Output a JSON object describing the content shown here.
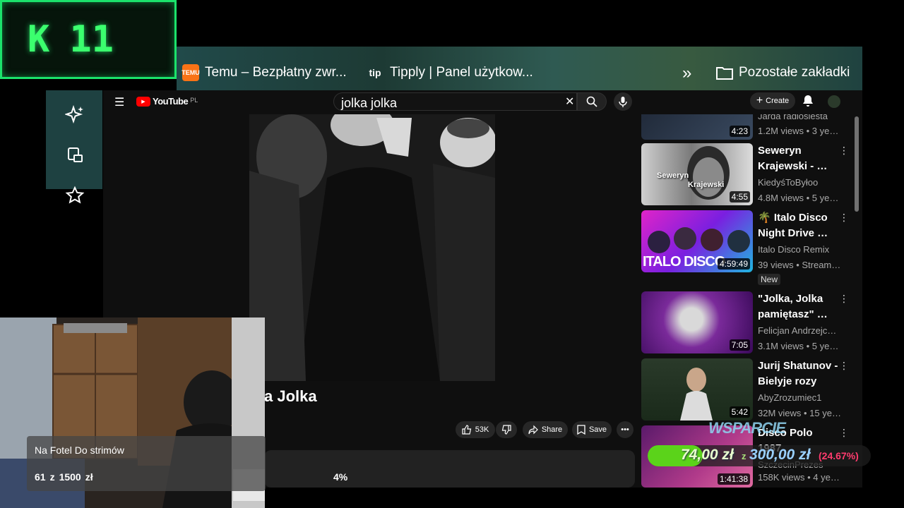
{
  "overlay": {
    "logo_letter": "K",
    "logo_number": "11",
    "goal_title": "Na Fotel Do strimów",
    "goal_current": "61",
    "goal_sep": "z",
    "goal_target": "1500",
    "goal_currency": "zł",
    "goal_percent": "4%",
    "support_label": "WSPARCIE",
    "donation_current": "74,00 zł",
    "donation_sep": "z",
    "donation_target": "300,00 zł",
    "donation_percent": "(24.67%)"
  },
  "bookmarks": [
    {
      "label": "Temu – Bezpłatny zwr...",
      "icon": "temu-icon",
      "icon_text": "TEMU"
    },
    {
      "label": "Tipply | Panel użytkow...",
      "icon": "tipply-icon",
      "icon_text": "tip"
    }
  ],
  "bookmarks_other": "Pozostałe zakładki",
  "youtube": {
    "logo_text": "YouTube",
    "region": "PL",
    "search_value": "jolka jolka",
    "create_label": "Create",
    "video_title_partial": "a Jolka",
    "likes": "53K",
    "share_label": "Share",
    "save_label": "Save"
  },
  "related": [
    {
      "title": "",
      "channel": "Jarda radiosiesta",
      "meta": "1.2M views • 3 ye…",
      "duration": "4:23",
      "badge": ""
    },
    {
      "title": "Seweryn Krajewski - …",
      "channel": "KiedyśToByłoo",
      "meta": "4.8M views • 5 ye…",
      "duration": "4:55",
      "badge": "",
      "thumb_text1": "Seweryn",
      "thumb_text2": "Krajewski"
    },
    {
      "title": "🌴 Italo Disco Night Drive …",
      "channel": "Italo Disco Remix",
      "meta": "39 views • Stream…",
      "duration": "4:59:49",
      "badge": "New",
      "thumb_text1": "ITALO DISCO"
    },
    {
      "title": "\"Jolka, Jolka pamiętasz\" …",
      "channel": "Felicjan Andrzejc…",
      "meta": "3.1M views • 5 ye…",
      "duration": "7:05",
      "badge": ""
    },
    {
      "title": "Jurij Shatunov - Bielyje rozy",
      "channel": "AbyZrozumiec1",
      "meta": "32M views • 15 ye…",
      "duration": "5:42",
      "badge": ""
    },
    {
      "title": "Disco Polo 1987",
      "channel": "SzczecinPrezes",
      "meta": "158K views • 4 ye…",
      "duration": "1:41:38",
      "badge": ""
    }
  ]
}
